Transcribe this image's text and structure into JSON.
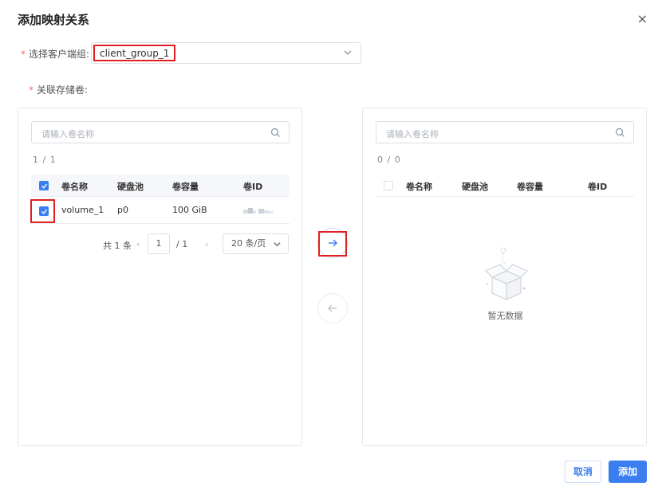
{
  "dialog": {
    "title": "添加映射关系",
    "close_glyph": "×"
  },
  "form": {
    "required_mark": "*",
    "client_group_label": "选择客户端组:",
    "client_group_value": "client_group_1",
    "volumes_label": "关联存储卷:"
  },
  "left_panel": {
    "search_placeholder": "请输入卷名称",
    "count": "1 / 1",
    "columns": [
      "卷名称",
      "硬盘池",
      "卷容量",
      "卷ID"
    ],
    "rows": [
      {
        "name": "volume_1",
        "pool": "p0",
        "capacity": "100 GiB",
        "checked": true
      }
    ],
    "header_checked": true,
    "pager": {
      "total": "共 1 条",
      "prev": "‹",
      "page": "1",
      "of": "/ 1",
      "next": "›",
      "page_size": "20 条/页"
    }
  },
  "right_panel": {
    "search_placeholder": "请输入卷名称",
    "count": "0 / 0",
    "columns": [
      "卷名称",
      "硬盘池",
      "卷容量",
      "卷ID"
    ],
    "empty_text": "暂无数据"
  },
  "transfer": {
    "to_right": "→",
    "to_left": "←"
  },
  "footer": {
    "cancel": "取消",
    "confirm": "添加"
  },
  "colors": {
    "primary": "#3a7ef0",
    "highlight": "#e02020",
    "required": "#f56c6c"
  }
}
